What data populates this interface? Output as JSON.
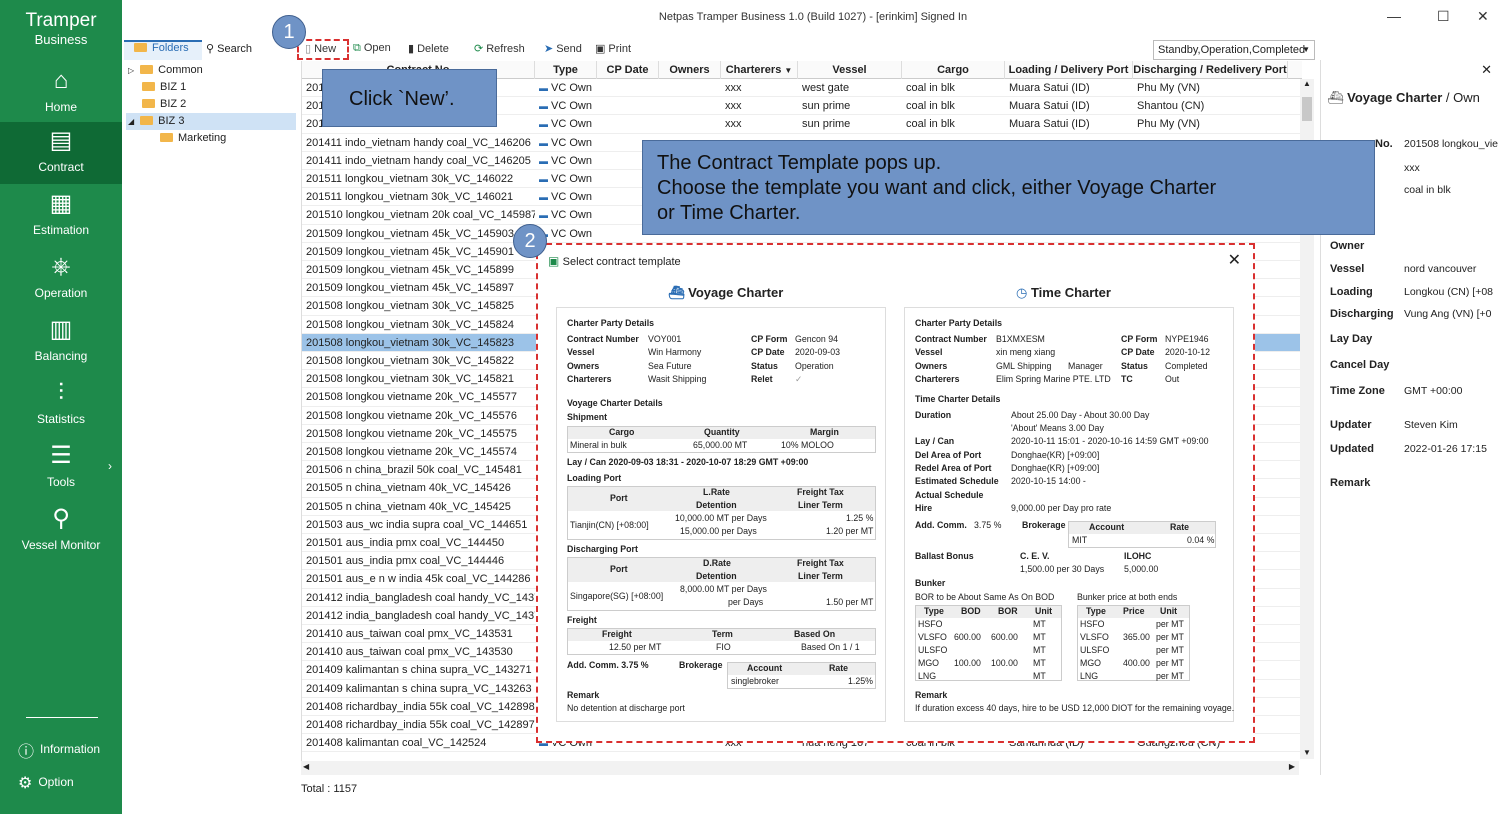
{
  "app": {
    "title": "Netpas Tramper Business 1.0 (Build 1027) - [erinkim] Signed In",
    "brand_top": "Tramper",
    "brand_bottom": "Business"
  },
  "sidebar": {
    "items": [
      {
        "label": "Home",
        "icon": "home-icon"
      },
      {
        "label": "Contract",
        "icon": "contract-icon",
        "active": true
      },
      {
        "label": "Estimation",
        "icon": "calculator-icon"
      },
      {
        "label": "Operation",
        "icon": "ship-wheel-icon"
      },
      {
        "label": "Balancing",
        "icon": "calendar-icon"
      },
      {
        "label": "Statistics",
        "icon": "chart-icon"
      },
      {
        "label": "Tools",
        "icon": "tools-icon"
      },
      {
        "label": "Vessel Monitor",
        "icon": "person-pin-icon"
      }
    ],
    "information": "Information",
    "option": "Option"
  },
  "left_tabs": {
    "folders": "Folders",
    "search": "Search"
  },
  "tree": [
    {
      "label": "Common",
      "level": 0,
      "expanded": false
    },
    {
      "label": "BIZ 1",
      "level": 0
    },
    {
      "label": "BIZ 2",
      "level": 0
    },
    {
      "label": "BIZ 3",
      "level": 0,
      "expanded": true,
      "selected": true
    },
    {
      "label": "Marketing",
      "level": 1
    }
  ],
  "toolbar": {
    "new": "New",
    "open": "Open",
    "delete": "Delete",
    "refresh": "Refresh",
    "send": "Send",
    "print": "Print",
    "filter": "Standby,Operation,Completed"
  },
  "grid": {
    "columns": [
      "Contract No",
      "Type",
      "CP Date",
      "Owners",
      "Charterers",
      "Vessel",
      "Cargo",
      "Loading / Delivery Port",
      "Discharging / Redelivery Port"
    ],
    "rows": [
      {
        "no": "201...210",
        "type": "VC Own",
        "charterers": "xxx",
        "vessel": "west gate",
        "cargo": "coal in blk",
        "load": "Muara Satui (ID)",
        "disch": "Phu My (VN)"
      },
      {
        "no": "201...209",
        "type": "VC Own",
        "charterers": "xxx",
        "vessel": "sun prime",
        "cargo": "coal in blk",
        "load": "Muara Satui (ID)",
        "disch": "Shantou (CN)"
      },
      {
        "no": "201...208",
        "type": "VC Own",
        "charterers": "xxx",
        "vessel": "sun prime",
        "cargo": "coal in blk",
        "load": "Muara Satui (ID)",
        "disch": "Phu My (VN)"
      },
      {
        "no": "201411 indo_vietnam handy coal_VC_146206",
        "type": "VC Own"
      },
      {
        "no": "201411 indo_vietnam handy coal_VC_146205",
        "type": "VC Own"
      },
      {
        "no": "201511 longkou_vietnam 30k_VC_146022",
        "type": "VC Own"
      },
      {
        "no": "201511 longkou_vietnam 30k_VC_146021",
        "type": "VC Own"
      },
      {
        "no": "201510 longkou_vietnam 20k coal_VC_145987",
        "type": "VC Own"
      },
      {
        "no": "201509 longkou_vietnam 45k_VC_145903",
        "type": "VC Own"
      },
      {
        "no": "201509 longkou_vietnam 45k_VC_145901"
      },
      {
        "no": "201509 longkou_vietnam 45k_VC_145899"
      },
      {
        "no": "201509 longkou_vietnam 45k_VC_145897"
      },
      {
        "no": "201508 longkou_vietnam 30k_VC_145825"
      },
      {
        "no": "201508 longkou_vietnam 30k_VC_145824"
      },
      {
        "no": "201508 longkou_vietnam 30k_VC_145823",
        "selected": true
      },
      {
        "no": "201508 longkou_vietnam 30k_VC_145822"
      },
      {
        "no": "201508 longkou_vietnam 30k_VC_145821"
      },
      {
        "no": "201508 longkou vietname 20k_VC_145577"
      },
      {
        "no": "201508 longkou vietname 20k_VC_145576"
      },
      {
        "no": "201508 longkou vietname 20k_VC_145575"
      },
      {
        "no": "201508 longkou vietname 20k_VC_145574"
      },
      {
        "no": "201506 n china_brazil 50k coal_VC_145481"
      },
      {
        "no": "201505 n china_vietnam 40k_VC_145426"
      },
      {
        "no": "201505 n china_vietnam 40k_VC_145425"
      },
      {
        "no": "201503 aus_wc india supra coal_VC_144651"
      },
      {
        "no": "201501 aus_india pmx coal_VC_144450"
      },
      {
        "no": "201501 aus_india pmx coal_VC_144446"
      },
      {
        "no": "201501 aus_e n w india 45k coal_VC_144286"
      },
      {
        "no": "201412 india_bangladesh coal handy_VC_143729"
      },
      {
        "no": "201412 india_bangladesh coal handy_VC_143728"
      },
      {
        "no": "201410 aus_taiwan coal pmx_VC_143531"
      },
      {
        "no": "201410 aus_taiwan coal pmx_VC_143530"
      },
      {
        "no": "201409 kalimantan s china supra_VC_143271"
      },
      {
        "no": "201409 kalimantan s china supra_VC_143263"
      },
      {
        "no": "201408 richardbay_india 55k coal_VC_142898"
      },
      {
        "no": "201408 richardbay_india 55k coal_VC_142897"
      },
      {
        "no": "201408 kalimantan coal_VC_142524",
        "type": "VC Own",
        "charterers": "xxx",
        "vessel": "hua heng 167",
        "cargo": "coal in blk",
        "load": "Samarinda (ID)",
        "disch": "Guangzhou (CN)"
      }
    ],
    "total": "Total : 1157"
  },
  "right_panel": {
    "heading_bold": "Voyage Charter",
    "heading_rest": " / Own",
    "no_label": "No.",
    "no_value": "201508 longkou_vie",
    "v2": "xxx",
    "v3": "coal in blk",
    "fields": [
      {
        "label": "Owner",
        "value": ""
      },
      {
        "label": "Vessel",
        "value": "nord vancouver"
      },
      {
        "label": "Loading",
        "value": "Longkou (CN) [+08"
      },
      {
        "label": "Discharging",
        "value": "Vung Ang (VN) [+0"
      },
      {
        "label": "Lay Day",
        "value": ""
      },
      {
        "label": "Cancel Day",
        "value": ""
      },
      {
        "label": "Time Zone",
        "value": "GMT +00:00"
      },
      {
        "label": "Updater",
        "value": "Steven Kim"
      },
      {
        "label": "Updated",
        "value": "2022-01-26 17:15"
      },
      {
        "label": "Remark",
        "value": ""
      }
    ]
  },
  "callouts": {
    "badge1": "1",
    "badge2": "2",
    "step1": "Click `New’.",
    "step2_line1": "The Contract Template pops up.",
    "step2_line2": "Choose the template you want and click, either Voyage Charter",
    "step2_line3": "or Time Charter."
  },
  "dialog": {
    "title": "Select contract template",
    "voyage": {
      "heading": "Voyage Charter",
      "cp_title": "Charter Party Details",
      "contract_no_l": "Contract Number",
      "contract_no": "VOY001",
      "vessel_l": "Vessel",
      "vessel": "Win Harmony",
      "owners_l": "Owners",
      "owners": "Sea Future",
      "charterers_l": "Charterers",
      "charterers": "Wasit Shipping",
      "cpform_l": "CP Form",
      "cpform": "Gencon 94",
      "cpdate_l": "CP Date",
      "cpdate": "2020-09-03",
      "status_l": "Status",
      "status": "Operation",
      "relet_l": "Relet",
      "relet": "✓",
      "vc_title": "Voyage Charter Details",
      "shipment": "Shipment",
      "ship_h": [
        "Cargo",
        "Quantity",
        "Margin"
      ],
      "ship_r": [
        "Mineral in bulk",
        "65,000.00 MT",
        "10% MOLOO"
      ],
      "laycan": "Lay / Can   2020-09-03 18:31 - 2020-10-07 18:29   GMT +09:00",
      "loading_title": "Loading Port",
      "lp_h": [
        "Port",
        "L.Rate",
        "Detention",
        "Freight Tax",
        "Liner Term"
      ],
      "lp_port": "Tianjin(CN) [+08:00]",
      "lp_v1": "10,000.00 MT per Days",
      "lp_v2": "15,000.00 per Days",
      "lp_t1": "1.25 %",
      "lp_t2": "1.20 per MT",
      "disch_title": "Discharging Port",
      "dp_h": [
        "Port",
        "D.Rate",
        "Detention",
        "Freight Tax",
        "Liner Term"
      ],
      "dp_port": "Singapore(SG) [+08:00]",
      "dp_v1": "8,000.00 MT per Days",
      "dp_v2": "per Days",
      "dp_t2": "1.50 per MT",
      "freight_title": "Freight",
      "fr_h": [
        "Freight",
        "Term",
        "Based On"
      ],
      "fr_r": [
        "12.50 per MT",
        "FIO",
        "Based On 1 / 1"
      ],
      "addcomm": "Add. Comm.   3.75 %",
      "brokerage_l": "Brokerage",
      "br_h": [
        "Account",
        "Rate"
      ],
      "br_r": [
        "singlebroker",
        "1.25%"
      ],
      "remark_l": "Remark",
      "remark": "No detention at discharge port"
    },
    "time": {
      "heading": "Time Charter",
      "cp_title": "Charter Party Details",
      "contract_no_l": "Contract Number",
      "contract_no": "B1XMXESM",
      "vessel_l": "Vessel",
      "vessel": "xin meng xiang",
      "owners_l": "Owners",
      "owners": "GML Shipping",
      "manager_l": "Manager",
      "charterers_l": "Charterers",
      "charterers": "Elim Spring Marine PTE. LTD",
      "cpform_l": "CP Form",
      "cpform": "NYPE1946",
      "cpdate_l": "CP Date",
      "cpdate": "2020-10-12",
      "status_l": "Status",
      "status": "Completed",
      "tc_l": "TC",
      "tc": "Out",
      "tc_title": "Time Charter Details",
      "duration_l": "Duration",
      "duration": "About 25.00 Day - About 30.00 Day",
      "duration2": "'About' Means 3.00 Day",
      "laycan_l": "Lay / Can",
      "laycan": "2020-10-11 15:01 - 2020-10-16 14:59   GMT +09:00",
      "del_l": "Del Area of Port",
      "del": "Donghae(KR) [+09:00]",
      "redel_l": "Redel Area of Port",
      "redel": "Donghae(KR) [+09:00]",
      "est_l": "Estimated Schedule",
      "est": "2020-10-15 14:00 -",
      "act_l": "Actual Schedule",
      "hire_l": "Hire",
      "hire": "9,000.00 per Day    pro rate",
      "addcomm_l": "Add. Comm.",
      "addcomm": "3.75 %",
      "brokerage_l": "Brokerage",
      "br_h": [
        "Account",
        "Rate"
      ],
      "br_r": [
        "MIT",
        "0.04 %"
      ],
      "ballast_l": "Ballast Bonus",
      "cev_l": "C. E. V.",
      "cev": "1,500.00 per 30 Days",
      "ilohc_l": "ILOHC",
      "ilohc": "5,000.00",
      "bunker_l": "Bunker",
      "bor_l": "BOR to be About Same As On BOD",
      "bp_l": "Bunker price at both ends",
      "bk_h": [
        "Type",
        "BOD",
        "BOR",
        "Unit"
      ],
      "bk_rows": [
        [
          "HSFO",
          "",
          "",
          "MT"
        ],
        [
          "VLSFO",
          "600.00",
          "600.00",
          "MT"
        ],
        [
          "ULSFO",
          "",
          "",
          "MT"
        ],
        [
          "MGO",
          "100.00",
          "100.00",
          "MT"
        ],
        [
          "LNG",
          "",
          "",
          "MT"
        ]
      ],
      "bp_h": [
        "Type",
        "Price",
        "Unit"
      ],
      "bp_rows": [
        [
          "HSFO",
          "",
          "per MT"
        ],
        [
          "VLSFO",
          "365.00",
          "per MT"
        ],
        [
          "ULSFO",
          "",
          "per MT"
        ],
        [
          "MGO",
          "400.00",
          "per MT"
        ],
        [
          "LNG",
          "",
          "per MT"
        ]
      ],
      "remark_l": "Remark",
      "remark": "If duration excess 40 days, hire to be USD 12,000 DIOT for the remaining voyage."
    }
  },
  "colors": {
    "sidebar": "#1e8a4b",
    "sidebar_active": "#0f6a35",
    "callout": "#6f93c6",
    "highlight": "#d93030",
    "selection": "#9cc3e8"
  }
}
